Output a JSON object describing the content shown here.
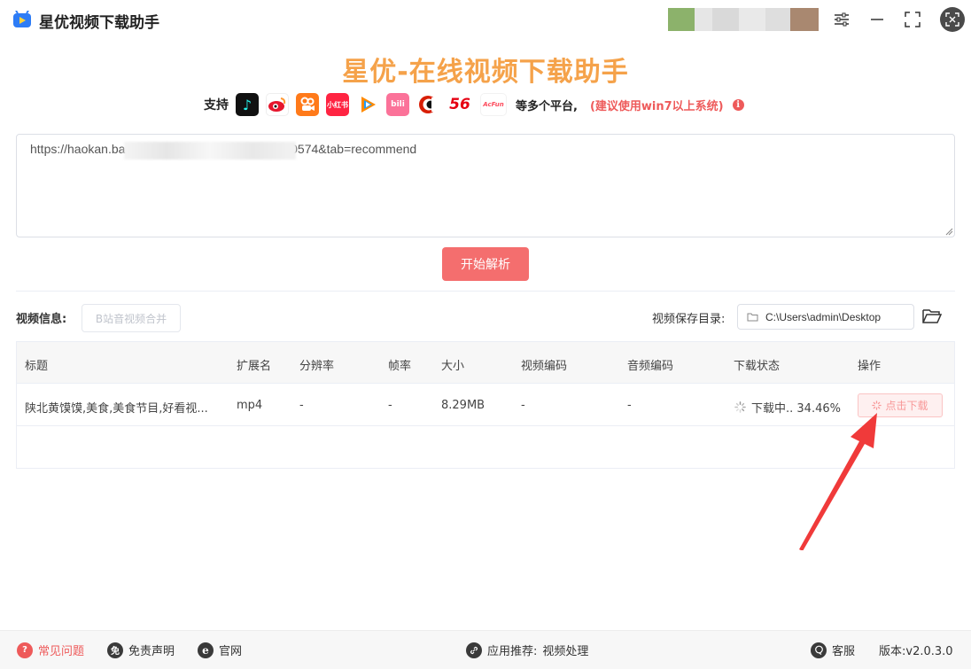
{
  "app": {
    "title": "星优视频下载助手",
    "headline": "星优-在线视频下载助手"
  },
  "platforms": {
    "support_label": "支持",
    "items": [
      {
        "name": "douyin-icon",
        "text": "♪",
        "color": "#111111"
      },
      {
        "name": "weibo-icon",
        "text": "微",
        "color": "#ffffff"
      },
      {
        "name": "kuaishou-icon",
        "text": "快",
        "color": "#ff7a1a"
      },
      {
        "name": "xiaohongshu-icon",
        "text": "小红书",
        "color": "#ff2442"
      },
      {
        "name": "tencent-video-icon",
        "text": "▶",
        "color": "#ffffff"
      },
      {
        "name": "bilibili-icon",
        "text": "bili",
        "color": "#fb7299"
      },
      {
        "name": "cctv-icon",
        "text": "C",
        "color": "#ffffff"
      },
      {
        "name": "56-icon",
        "text": "56",
        "color": "#ffffff"
      },
      {
        "name": "acfun-icon",
        "text": "AcFun",
        "color": "#ffffff"
      }
    ],
    "more_label": "等多个平台,",
    "hint_label": "(建议使用win7以上系统)",
    "info_mark": "i"
  },
  "input": {
    "url": "https://haokan.ba                                          8640574&tab=recommend"
  },
  "actions": {
    "parse_label": "开始解析",
    "merge_label": "B站音视频合并"
  },
  "video_info_label": "视频信息:",
  "save_dir": {
    "label": "视频保存目录:",
    "path": "C:\\Users\\admin\\Desktop"
  },
  "table": {
    "headers": [
      "标题",
      "扩展名",
      "分辨率",
      "帧率",
      "大小",
      "视频编码",
      "音频编码",
      "下载状态",
      "操作"
    ],
    "rows": [
      {
        "title": "陕北黄馍馍,美食,美食节目,好看视...",
        "ext": "mp4",
        "resolution": "-",
        "fps": "-",
        "size": "8.29MB",
        "vcodec": "-",
        "acodec": "-",
        "status": "下载中.. 34.46%",
        "action": "点击下载"
      }
    ]
  },
  "footer": {
    "faq": "常见问题",
    "faq_icon": "?",
    "disclaimer": "免责声明",
    "disclaimer_icon": "免",
    "website": "官网",
    "website_icon": "e",
    "recommend": "应用推荐:",
    "recommend_app": "视频处理",
    "service": "客服",
    "version": "版本:v2.0.3.0"
  },
  "colors": {
    "accent": "#f46e6e",
    "headline": "#f5a24a",
    "hint": "#ee5a5a"
  }
}
